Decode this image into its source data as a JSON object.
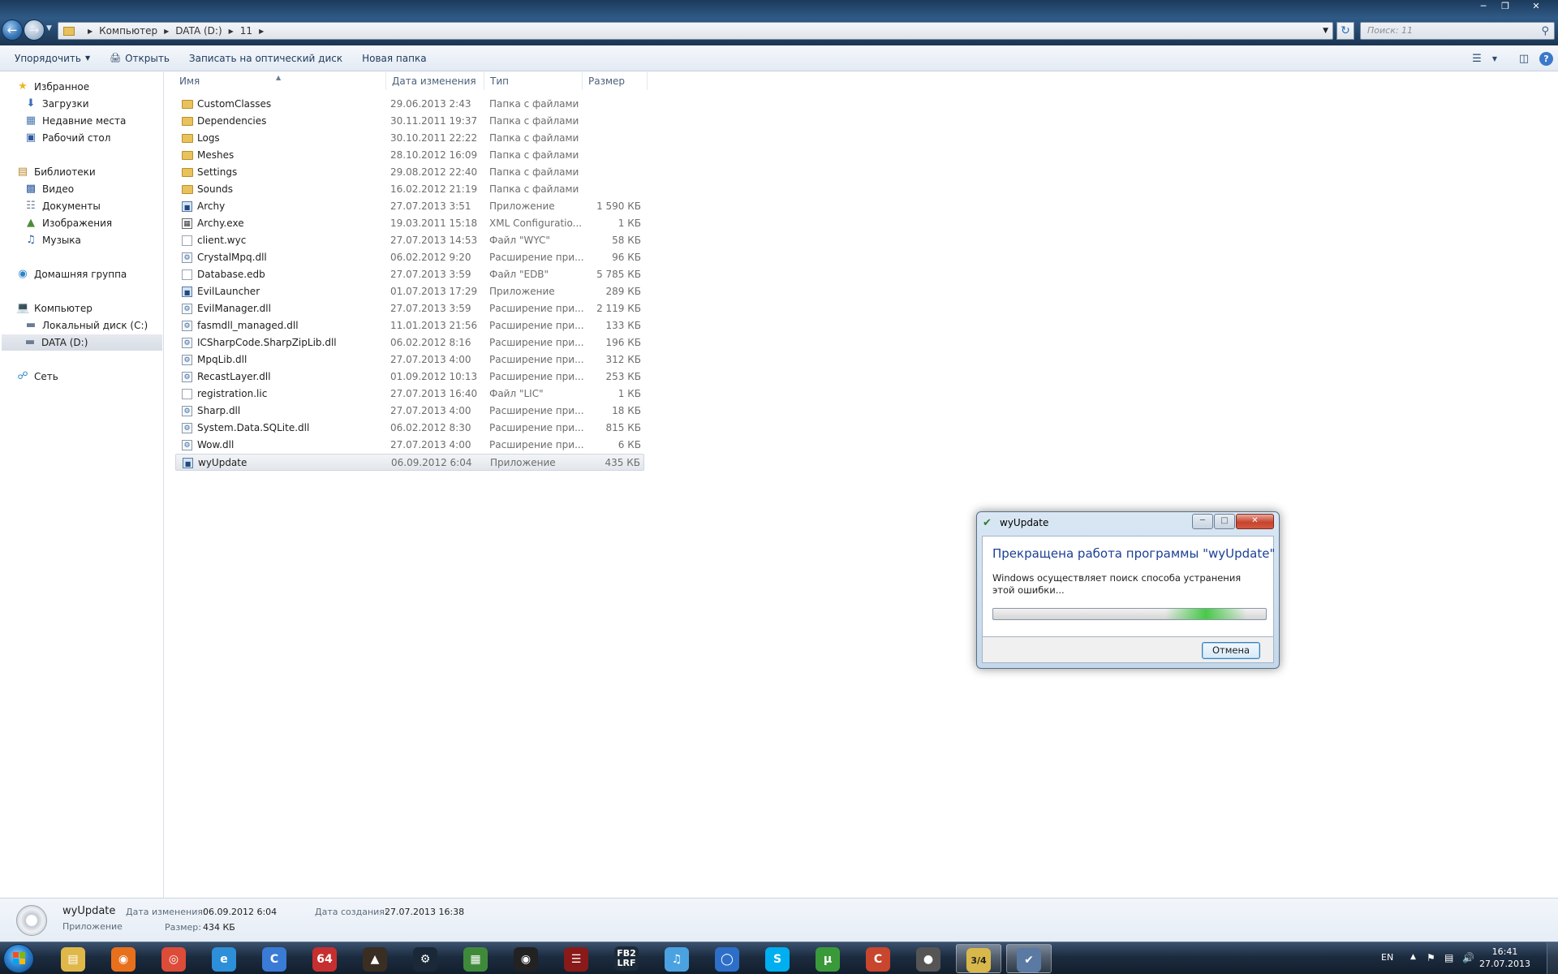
{
  "address": {
    "crumbs": [
      "Компьютер",
      "DATA (D:)",
      "11"
    ],
    "search_placeholder": "Поиск: 11"
  },
  "toolbar": {
    "organize": "Упорядочить",
    "open": "Открыть",
    "burn": "Записать на оптический диск",
    "new_folder": "Новая папка"
  },
  "nav": {
    "favorites": "Избранное",
    "downloads": "Загрузки",
    "recent": "Недавние места",
    "desktop": "Рабочий стол",
    "libraries": "Библиотеки",
    "video": "Видео",
    "documents": "Документы",
    "images": "Изображения",
    "music": "Музыка",
    "homegroup": "Домашняя группа",
    "computer": "Компьютер",
    "local_disk": "Локальный диск (C:)",
    "data_disk": "DATA (D:)",
    "network": "Сеть"
  },
  "columns": {
    "name": "Имя",
    "date": "Дата изменения",
    "type": "Тип",
    "size": "Размер"
  },
  "files": [
    {
      "name": "CustomClasses",
      "date": "29.06.2013 2:43",
      "type": "Папка с файлами",
      "size": "",
      "icon": "folder"
    },
    {
      "name": "Dependencies",
      "date": "30.11.2011 19:37",
      "type": "Папка с файлами",
      "size": "",
      "icon": "folder"
    },
    {
      "name": "Logs",
      "date": "30.10.2011 22:22",
      "type": "Папка с файлами",
      "size": "",
      "icon": "folder"
    },
    {
      "name": "Meshes",
      "date": "28.10.2012 16:09",
      "type": "Папка с файлами",
      "size": "",
      "icon": "folder"
    },
    {
      "name": "Settings",
      "date": "29.08.2012 22:40",
      "type": "Папка с файлами",
      "size": "",
      "icon": "folder"
    },
    {
      "name": "Sounds",
      "date": "16.02.2012 21:19",
      "type": "Папка с файлами",
      "size": "",
      "icon": "folder"
    },
    {
      "name": "Archy",
      "date": "27.07.2013 3:51",
      "type": "Приложение",
      "size": "1 590 КБ",
      "icon": "app"
    },
    {
      "name": "Archy.exe",
      "date": "19.03.2011 15:18",
      "type": "XML Configuratio...",
      "size": "1 КБ",
      "icon": "exe"
    },
    {
      "name": "client.wyc",
      "date": "27.07.2013 14:53",
      "type": "Файл \"WYC\"",
      "size": "58 КБ",
      "icon": "doc"
    },
    {
      "name": "CrystalMpq.dll",
      "date": "06.02.2012 9:20",
      "type": "Расширение при...",
      "size": "96 КБ",
      "icon": "dll"
    },
    {
      "name": "Database.edb",
      "date": "27.07.2013 3:59",
      "type": "Файл \"EDB\"",
      "size": "5 785 КБ",
      "icon": "doc"
    },
    {
      "name": "EvilLauncher",
      "date": "01.07.2013 17:29",
      "type": "Приложение",
      "size": "289 КБ",
      "icon": "app"
    },
    {
      "name": "EvilManager.dll",
      "date": "27.07.2013 3:59",
      "type": "Расширение при...",
      "size": "2 119 КБ",
      "icon": "dll"
    },
    {
      "name": "fasmdll_managed.dll",
      "date": "11.01.2013 21:56",
      "type": "Расширение при...",
      "size": "133 КБ",
      "icon": "dll"
    },
    {
      "name": "ICSharpCode.SharpZipLib.dll",
      "date": "06.02.2012 8:16",
      "type": "Расширение при...",
      "size": "196 КБ",
      "icon": "dll"
    },
    {
      "name": "MpqLib.dll",
      "date": "27.07.2013 4:00",
      "type": "Расширение при...",
      "size": "312 КБ",
      "icon": "dll"
    },
    {
      "name": "RecastLayer.dll",
      "date": "01.09.2012 10:13",
      "type": "Расширение при...",
      "size": "253 КБ",
      "icon": "dll"
    },
    {
      "name": "registration.lic",
      "date": "27.07.2013 16:40",
      "type": "Файл \"LIC\"",
      "size": "1 КБ",
      "icon": "doc"
    },
    {
      "name": "Sharp.dll",
      "date": "27.07.2013 4:00",
      "type": "Расширение при...",
      "size": "18 КБ",
      "icon": "dll"
    },
    {
      "name": "System.Data.SQLite.dll",
      "date": "06.02.2012 8:30",
      "type": "Расширение при...",
      "size": "815 КБ",
      "icon": "dll"
    },
    {
      "name": "Wow.dll",
      "date": "27.07.2013 4:00",
      "type": "Расширение при...",
      "size": "6 КБ",
      "icon": "dll"
    },
    {
      "name": "wyUpdate",
      "date": "06.09.2012 6:04",
      "type": "Приложение",
      "size": "435 КБ",
      "icon": "app",
      "selected": true
    }
  ],
  "details": {
    "name": "wyUpdate",
    "kind": "Приложение",
    "modified_label": "Дата изменения:",
    "modified_value": "06.09.2012 6:04",
    "size_label": "Размер:",
    "size_value": "434 КБ",
    "created_label": "Дата создания:",
    "created_value": "27.07.2013 16:38"
  },
  "dialog": {
    "title": "wyUpdate",
    "heading": "Прекращена работа программы \"wyUpdate\"",
    "message": "Windows осуществляет поиск способа устранения этой ошибки...",
    "cancel": "Отмена",
    "progress_glow_position": 0.78
  },
  "taskbar": {
    "apps": [
      "explorer",
      "firefox",
      "chrome",
      "ie",
      "cclean",
      "aida64",
      "app-7",
      "steam",
      "app-9",
      "obs",
      "app-11",
      "FB2 LRF",
      "music",
      "app-14",
      "skype",
      "utorrent",
      "ccleaner",
      "gamepad",
      "calendar",
      "wyupdate"
    ],
    "fb2_label": "FB2 LRF",
    "cal_label": "3/4",
    "lang": "EN",
    "time": "16:41",
    "date": "27.07.2013"
  }
}
